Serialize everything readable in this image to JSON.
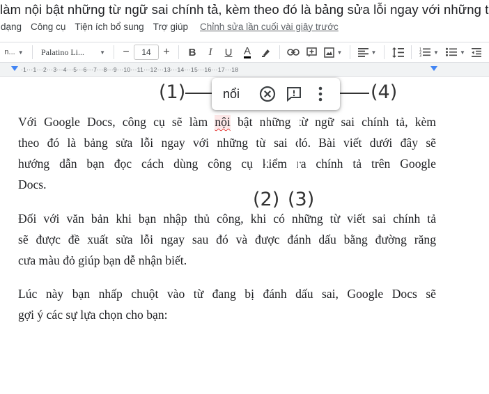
{
  "doc": {
    "title": "làm nội bật những từ ngữ sai chính tả, kèm theo đó là bảng sửa lỗi ngay với những từ..."
  },
  "menu": {
    "items": [
      "dạng",
      "Công cụ",
      "Tiện ích bổ sung",
      "Trợ giúp"
    ],
    "last_edit": "Chỉnh sửa lần cuối vài giây trước"
  },
  "toolbar": {
    "style_value": "n...",
    "font_value": "Palatino Li...",
    "size_value": "14",
    "minus": "−",
    "plus": "+",
    "bold": "B",
    "italic": "I",
    "underline": "U",
    "text_color": "A"
  },
  "ruler": {
    "numbers": "·1···1···2···3···4···5···6···7···8···9···10···11···12···13···14···15···16···17···18"
  },
  "document": {
    "p1": [
      [
        "Với Google Docs, công cụ sẽ làm ",
        "nội",
        " bật nh",
        "ững từ ngữ sai chính tả, kèm"
      ],
      "theo đó là bảng sửa lỗi ngay với những từ  sai đó. Bài viết dưới đây sẽ",
      "hướng dẫn bạn đọc cách dùng công cụ kiểm  ra chính tả trên Google",
      "Docs."
    ],
    "p2": [
      "Đối với văn bản khi bạn nhập thủ công, khi có những từ viết sai chính tả",
      "sẽ được đề xuất sửa lỗi ngay sau đó và được đánh dấu bằng đường răng",
      "cưa màu đỏ giúp bạn dễ nhận biết."
    ],
    "p3": [
      "Lúc này bạn nhấp chuột vào từ đang bị đánh dấu sai, Google Docs sẽ",
      "gợi ý các sự lựa chọn cho bạn:"
    ]
  },
  "popup": {
    "suggestion": "nổi"
  },
  "annotations": {
    "a1": "(1)",
    "a2": "(2)",
    "a3": "(3)",
    "a4": "(4)"
  },
  "icons": {
    "dismiss": "circle-x-icon",
    "comment": "comment-exclaim-icon",
    "more": "more-vert-icon"
  },
  "colors": {
    "error_underline": "#e53935",
    "accent": "#4285f4"
  }
}
